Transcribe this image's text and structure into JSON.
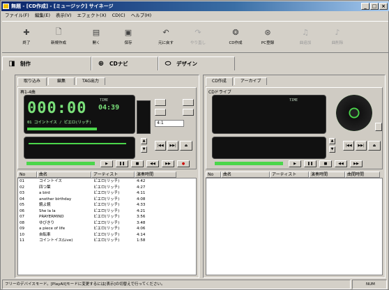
{
  "window": {
    "title": "無題 - [CD作成] - [ミュージック] サイネージ"
  },
  "menu": [
    "ファイル(F)",
    "編集(E)",
    "表示(V)",
    "エフェクト(X)",
    "CD(C)",
    "ヘルプ(H)"
  ],
  "toolbar": [
    {
      "label": "終了",
      "icon": "exit-icon",
      "glyph": "✚",
      "enabled": true
    },
    {
      "label": "新規作成",
      "icon": "new-file-icon",
      "glyph": "🗋",
      "enabled": true
    },
    {
      "label": "開く",
      "icon": "open-icon",
      "glyph": "▤",
      "enabled": true
    },
    {
      "label": "保存",
      "icon": "save-icon",
      "glyph": "▣",
      "enabled": true
    },
    {
      "label": "元に戻す",
      "icon": "undo-icon",
      "glyph": "↶",
      "enabled": true
    },
    {
      "label": "やり直し",
      "icon": "redo-icon",
      "glyph": "↷",
      "enabled": false
    },
    {
      "label": "CD作成",
      "icon": "cd-burn-icon",
      "glyph": "❂",
      "enabled": true
    },
    {
      "label": "PC登録",
      "icon": "register-icon",
      "glyph": "⊛",
      "enabled": true
    },
    {
      "label": "曲追加",
      "icon": "add-track-icon",
      "glyph": "♫",
      "enabled": false
    },
    {
      "label": "曲削除",
      "icon": "delete-track-icon",
      "glyph": "♪",
      "enabled": false
    }
  ],
  "modetabs": [
    {
      "label": "制作",
      "icon": "create-icon",
      "glyph": "◨"
    },
    {
      "label": "CDナビ",
      "icon": "cd-navi-icon",
      "glyph": "⊕"
    },
    {
      "label": "デザイン",
      "icon": "design-icon",
      "glyph": "⬭"
    }
  ],
  "left": {
    "tabs": [
      "取り込み",
      "編集",
      "TAG出力"
    ],
    "device_label": "再1-4曲",
    "time_display": "000:00",
    "time_small": "04:39",
    "tag": "TIME",
    "track_line": "01 コイントイス / ビエロ(リッチ)",
    "select_value": "4:1",
    "list_header": [
      "No",
      "曲名",
      "アーティスト",
      "演奏時間"
    ],
    "tracks": [
      [
        "01",
        "コイントイス",
        "ビエロ(リッチ)",
        "4:42"
      ],
      [
        "02",
        "四つ葉",
        "ビエロ(リッチ)",
        "4:27"
      ],
      [
        "03",
        "a bird",
        "ビエロ(リッチ)",
        "4:11"
      ],
      [
        "04",
        "another birthday",
        "ビエロ(リッチ)",
        "4:08"
      ],
      [
        "05",
        "鏡よ鏡",
        "ビエロ(リッチ)",
        "4:33"
      ],
      [
        "06",
        "She la la",
        "ビエロ(リッチ)",
        "4:21"
      ],
      [
        "07",
        "PRAYERMIND",
        "ビエロ(リッチ)",
        "3:56"
      ],
      [
        "08",
        "ゆびきり",
        "ビエロ(リッチ)",
        "3:48"
      ],
      [
        "09",
        "a piece of life",
        "ビエロ(リッチ)",
        "4:06"
      ],
      [
        "10",
        "自転車",
        "ビエロ(リッチ)",
        "4:14"
      ],
      [
        "11",
        "コイントイス(Live)",
        "ビエロ(リッチ)",
        "1:58"
      ]
    ]
  },
  "right": {
    "tabs": [
      "CD作成",
      "アーカイブ"
    ],
    "device_label": "CDドライブ",
    "tag": "TIME",
    "list_header": [
      "No",
      "曲名",
      "アーティスト",
      "演奏時間",
      "曲間時間"
    ]
  },
  "status": {
    "main": "フリーのデバイスモード。[PlayAll]モードに変更するには[表示]の切替えで行ってください。",
    "cap": "NUM"
  }
}
